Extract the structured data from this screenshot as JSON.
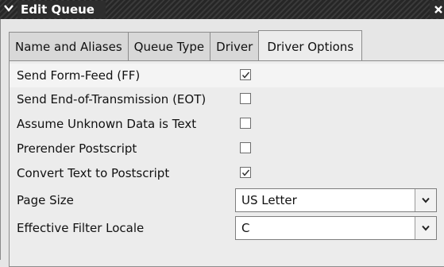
{
  "window": {
    "title": "Edit Queue",
    "menu_glyph": "⌄",
    "close_glyph": "✕"
  },
  "tabs": [
    {
      "label": "Name and Aliases",
      "active": false
    },
    {
      "label": "Queue Type",
      "active": false
    },
    {
      "label": "Driver",
      "active": false
    },
    {
      "label": "Driver Options",
      "active": true
    }
  ],
  "options": [
    {
      "label": "Send Form-Feed (FF)",
      "checked": true
    },
    {
      "label": "Send End-of-Transmission (EOT)",
      "checked": false
    },
    {
      "label": "Assume Unknown Data is Text",
      "checked": false
    },
    {
      "label": "Prerender Postscript",
      "checked": false
    },
    {
      "label": "Convert Text to Postscript",
      "checked": true
    }
  ],
  "selects": [
    {
      "label": "Page Size",
      "value": "US Letter"
    },
    {
      "label": "Effective Filter Locale",
      "value": "C"
    }
  ],
  "colors": {
    "titlebar": "#2d2d2d",
    "panel": "#ececec",
    "highlight": "#f4f4f4"
  }
}
